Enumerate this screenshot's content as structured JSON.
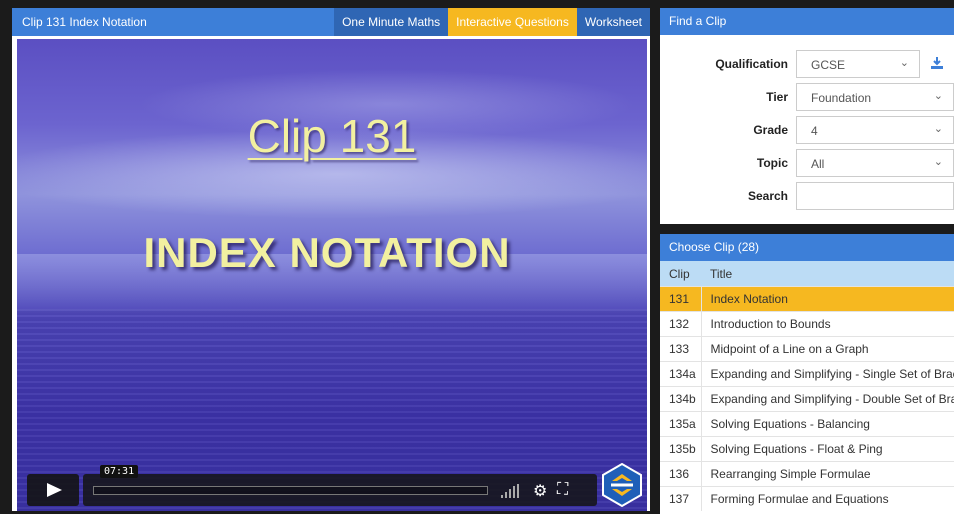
{
  "video_panel": {
    "title": "Clip 131 Index Notation",
    "buttons": {
      "one_minute": "One Minute Maths",
      "interactive": "Interactive Questions",
      "worksheet": "Worksheet"
    },
    "slide": {
      "heading": "Clip 131",
      "subject": "INDEX NOTATION"
    },
    "player": {
      "time": "07:31",
      "progress": 0
    }
  },
  "find_panel": {
    "header": "Find a Clip",
    "fields": {
      "qualification": {
        "label": "Qualification",
        "value": "GCSE"
      },
      "tier": {
        "label": "Tier",
        "value": "Foundation"
      },
      "grade": {
        "label": "Grade",
        "value": "4"
      },
      "topic": {
        "label": "Topic",
        "value": "All"
      },
      "search": {
        "label": "Search",
        "value": ""
      }
    }
  },
  "choose_panel": {
    "header": "Choose Clip (28)",
    "columns": {
      "clip": "Clip",
      "title": "Title"
    },
    "rows": [
      {
        "clip": "131",
        "title": "Index Notation",
        "selected": true
      },
      {
        "clip": "132",
        "title": "Introduction to Bounds"
      },
      {
        "clip": "133",
        "title": "Midpoint of a Line on a Graph"
      },
      {
        "clip": "134a",
        "title": "Expanding and Simplifying - Single Set of Brac"
      },
      {
        "clip": "134b",
        "title": "Expanding and Simplifying - Double Set of Bra"
      },
      {
        "clip": "135a",
        "title": "Solving Equations - Balancing"
      },
      {
        "clip": "135b",
        "title": "Solving Equations - Float & Ping"
      },
      {
        "clip": "136",
        "title": "Rearranging Simple Formulae"
      },
      {
        "clip": "137",
        "title": "Forming Formulae and Equations"
      }
    ]
  },
  "colors": {
    "header_blue": "#3d7fd8",
    "accent_yellow": "#f6b820",
    "table_header": "#bcdcf5"
  }
}
